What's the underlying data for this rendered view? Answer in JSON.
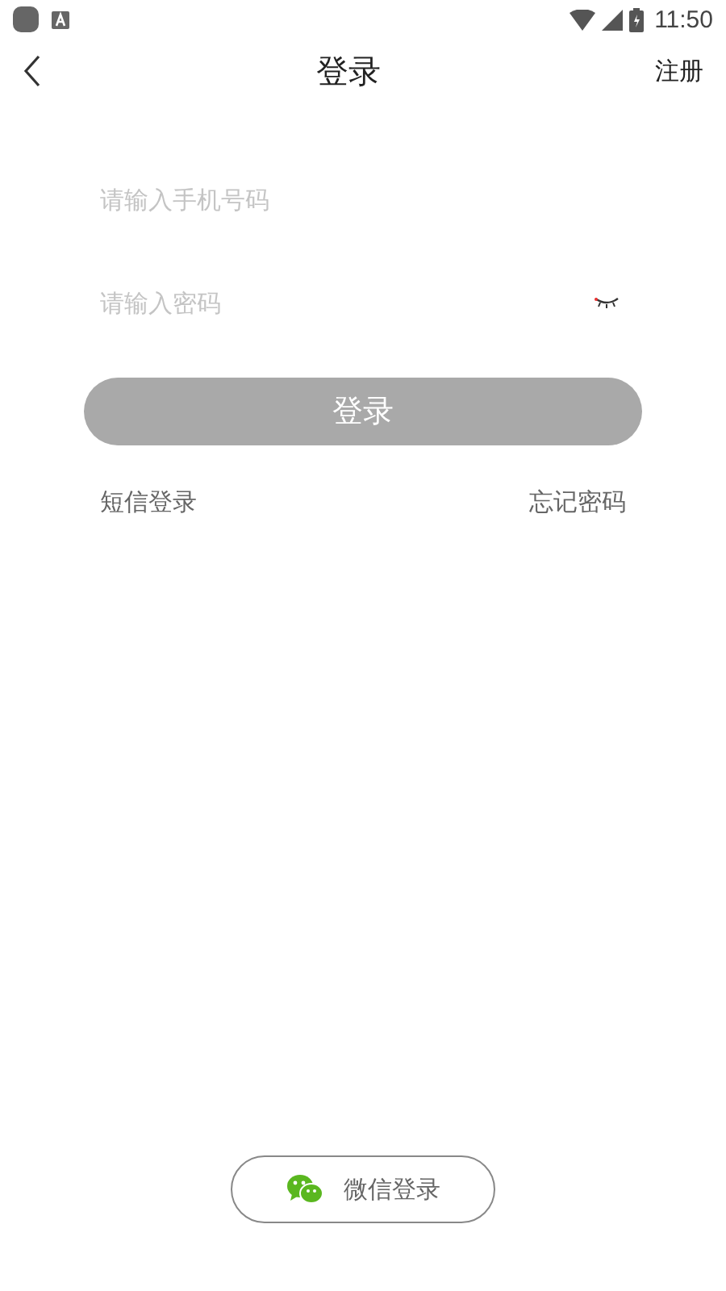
{
  "status_bar": {
    "time": "11:50"
  },
  "nav": {
    "title": "登录",
    "action": "注册"
  },
  "phone_field": {
    "placeholder": "请输入手机号码"
  },
  "password_field": {
    "placeholder": "请输入密码",
    "visible": false
  },
  "login_button": {
    "label": "登录",
    "disabled": true
  },
  "links": {
    "left": "短信登录",
    "right": "忘记密码"
  },
  "wechat_button": {
    "label": "微信登录"
  }
}
